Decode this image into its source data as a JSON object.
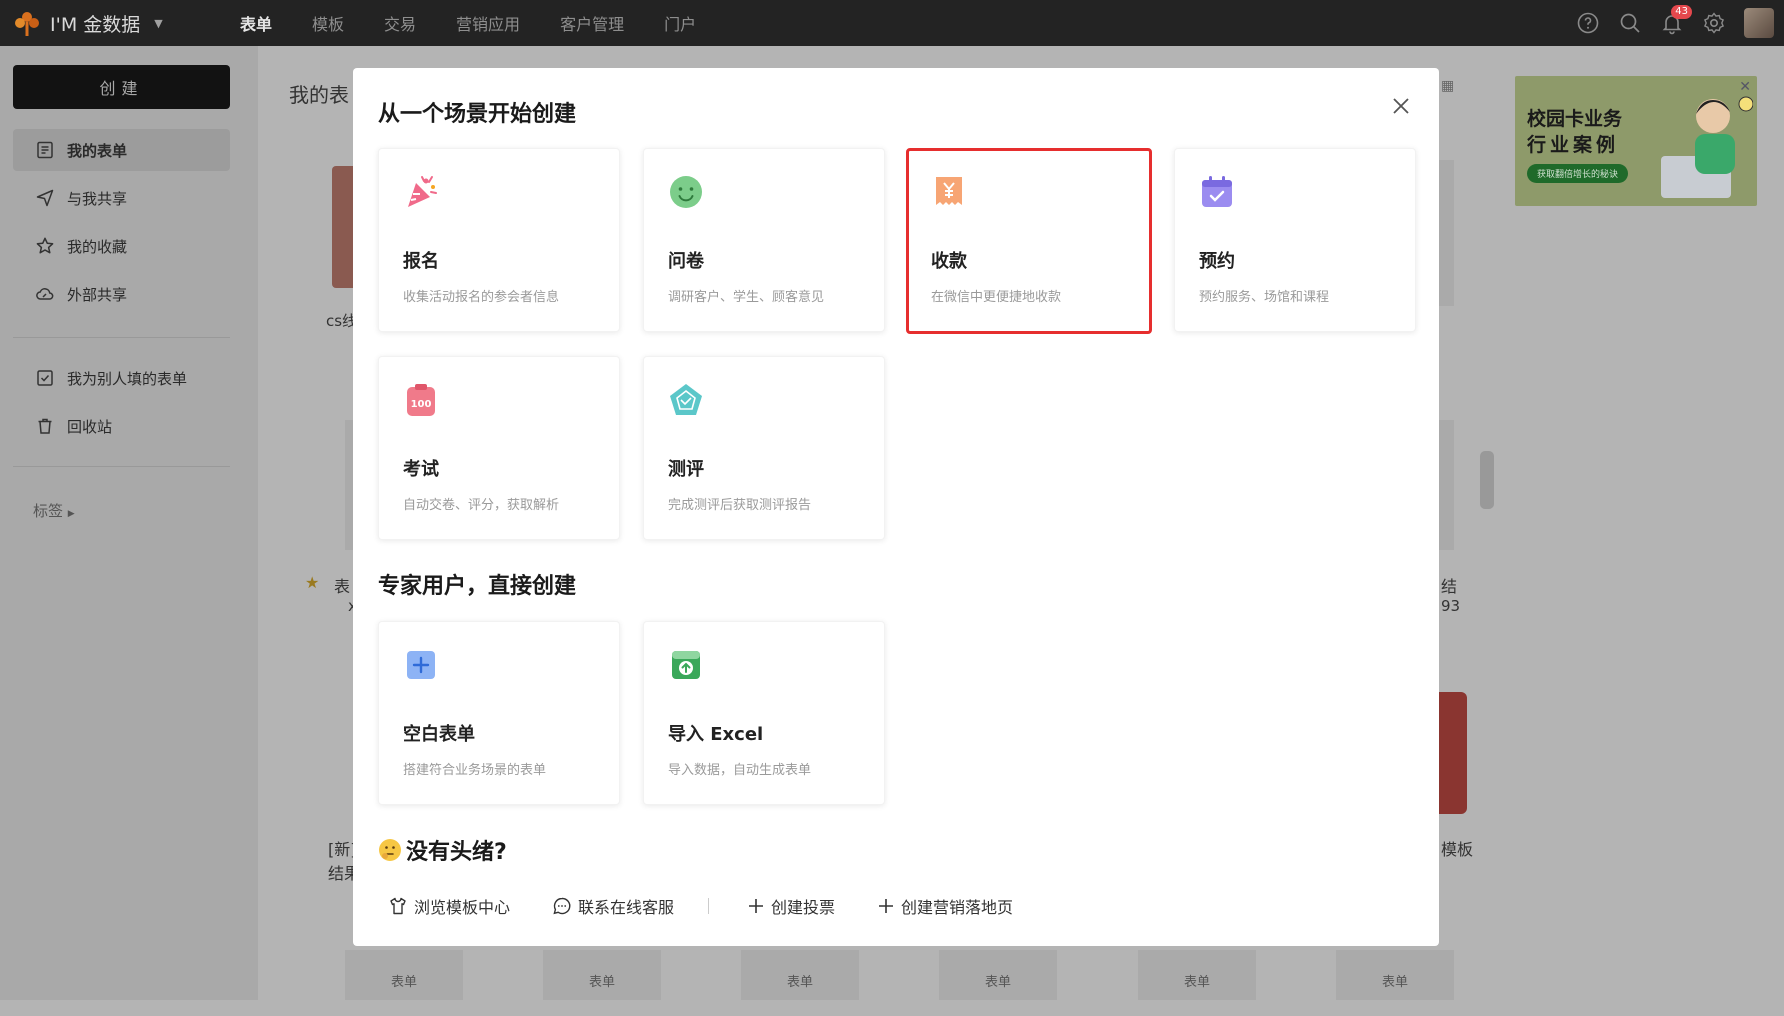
{
  "app": {
    "title": "I'M 金数据"
  },
  "nav": [
    "表单",
    "模板",
    "交易",
    "营销应用",
    "客户管理",
    "门户"
  ],
  "notifications": {
    "count": "43"
  },
  "sidebar": {
    "create_label": "创建",
    "items": [
      "我的表单",
      "与我共享",
      "我的收藏",
      "外部共享"
    ],
    "items2": [
      "我为别人填的表单",
      "回收站"
    ],
    "tags_label": "标签"
  },
  "background": {
    "page_title": "我的表",
    "labels": [
      "cs线",
      "表",
      "x",
      "[新]",
      "结果",
      "结",
      "93",
      "模板"
    ],
    "tab_label": "表单"
  },
  "ad": {
    "line1": "校园卡业务",
    "line2": "行业案例",
    "button": "获取翻倍增长的秘诀"
  },
  "modal": {
    "section1_title": "从一个场景开始创建",
    "scenes": [
      {
        "title": "报名",
        "desc": "收集活动报名的参会者信息",
        "icon": "party-popper-icon"
      },
      {
        "title": "问卷",
        "desc": "调研客户、学生、顾客意见",
        "icon": "smiley-icon"
      },
      {
        "title": "收款",
        "desc": "在微信中更便捷地收款",
        "icon": "yuan-receipt-icon"
      },
      {
        "title": "预约",
        "desc": "预约服务、场馆和课程",
        "icon": "calendar-check-icon"
      },
      {
        "title": "考试",
        "desc": "自动交卷、评分，获取解析",
        "icon": "score-100-icon"
      },
      {
        "title": "测评",
        "desc": "完成测评后获取测评报告",
        "icon": "pentagon-icon"
      }
    ],
    "section2_title": "专家用户，直接创建",
    "expert": [
      {
        "title": "空白表单",
        "desc": "搭建符合业务场景的表单",
        "icon": "plus-icon"
      },
      {
        "title": "导入 Excel",
        "desc": "导入数据，自动生成表单",
        "icon": "upload-icon"
      }
    ],
    "section3_title": "没有头绪?",
    "help": [
      "浏览模板中心",
      "联系在线客服",
      "创建投票",
      "创建营销落地页"
    ]
  }
}
